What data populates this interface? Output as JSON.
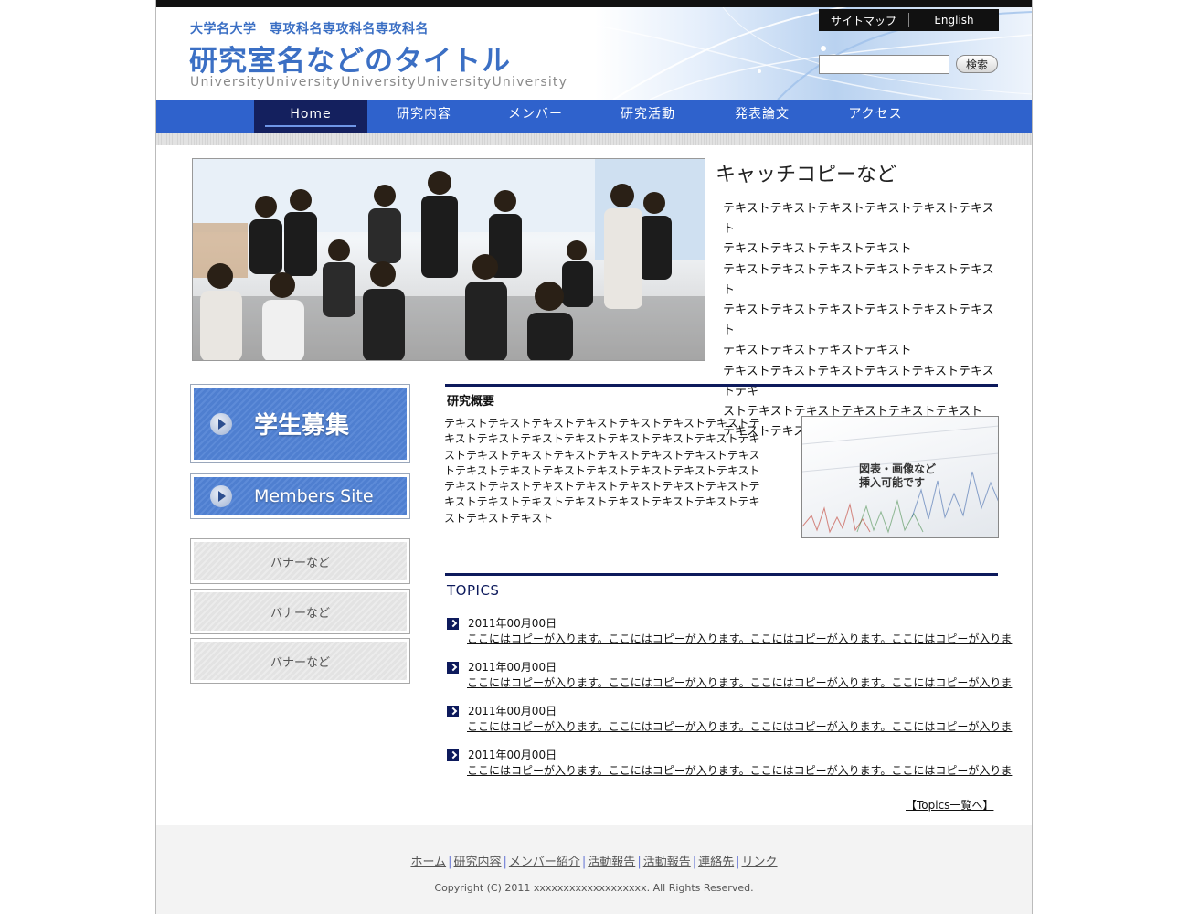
{
  "header": {
    "university": "大学名大学　専攻科名専攻科名専攻科名",
    "title": "研究室名などのタイトル",
    "university_en": "UniversityUniversityUniversityUniversityUniversity",
    "utility_links": [
      "サイトマップ",
      "English"
    ],
    "search_placeholder": "",
    "search_button": "検索"
  },
  "nav": {
    "items": [
      "Home",
      "研究内容",
      "メンバー",
      "研究活動",
      "発表論文",
      "アクセス"
    ],
    "active": "Home"
  },
  "hero": {
    "catch": "キャッチコピーなど",
    "lines": [
      "テキストテキストテキストテキストテキストテキスト",
      "テキストテキストテキストテキスト",
      "テキストテキストテキストテキストテキストテキスト",
      "テキストテキストテキストテキストテキストテキスト",
      "テキストテキストテキストテキスト",
      "テキストテキストテキストテキストテキストテキストテキ",
      "ストテキストテキストテキストテキストテキスト",
      "テキストテキストテキストテキスト"
    ]
  },
  "sidebar": {
    "recruit_banner": "学生募集",
    "members_banner": "Members Site",
    "small_banners": [
      "バナーなど",
      "バナーなど",
      "バナーなど"
    ]
  },
  "overview": {
    "heading": "研究概要",
    "lines": [
      "テキストテキストテキストテキストテキストテキストテキストテ",
      "キストテキストテキストテキストテキストテキストテキストテキ",
      "ストテキストテキストテキストテキストテキストテキストテキス",
      "トテキストテキストテキストテキストテキストテキストテキスト",
      "テキストテキストテキストテキストテキストテキストテキストテ",
      "キストテキストテキストテキストテキストテキストテキストテキ",
      "ストテキストテキスト"
    ],
    "figure_label": "図表・画像など\n挿入可能です"
  },
  "topics": {
    "heading": "TOPICS",
    "items": [
      {
        "date": "2011年00月00日",
        "text": "ここにはコピーが入ります。ここにはコピーが入ります。ここにはコピーが入ります。ここにはコピーが入りま"
      },
      {
        "date": "2011年00月00日",
        "text": "ここにはコピーが入ります。ここにはコピーが入ります。ここにはコピーが入ります。ここにはコピーが入りま"
      },
      {
        "date": "2011年00月00日",
        "text": "ここにはコピーが入ります。ここにはコピーが入ります。ここにはコピーが入ります。ここにはコピーが入りま"
      },
      {
        "date": "2011年00月00日",
        "text": "ここにはコピーが入ります。ここにはコピーが入ります。ここにはコピーが入ります。ここにはコピーが入りま"
      }
    ],
    "more": "【Topics一覧へ】"
  },
  "footer": {
    "links": [
      "ホーム",
      "研究内容",
      "メンバー紹介",
      "活動報告",
      "活動報告",
      "連絡先",
      "リンク"
    ],
    "copyright": "Copyright (C) 2011 xxxxxxxxxxxxxxxxxxx. All Rights Reserved."
  },
  "colors": {
    "brand_blue": "#2f62cc",
    "nav_active": "#14205e",
    "title_blue": "#3b6fc4",
    "rule_navy": "#0d1a5c"
  }
}
